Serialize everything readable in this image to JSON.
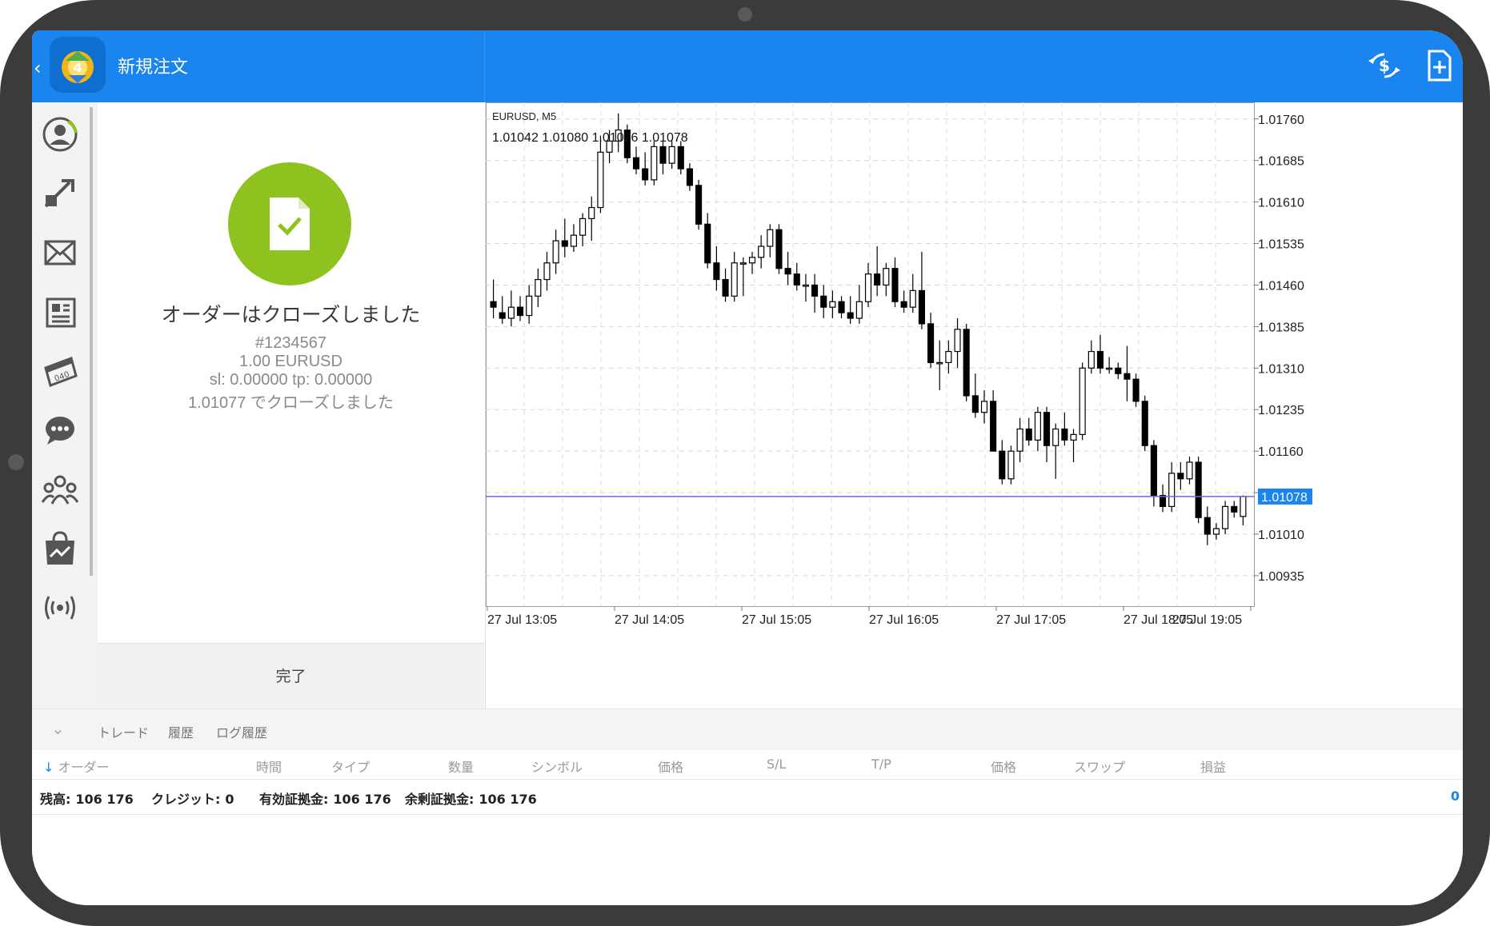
{
  "header": {
    "title": "新規注文"
  },
  "order_result": {
    "message": "オーダーはクローズしました",
    "ticket": "#1234567",
    "volume_symbol": "1.00 EURUSD",
    "sl_tp": "sl: 0.00000 tp: 0.00000",
    "close_text": "1.01077 でクローズしました",
    "done_label": "完了"
  },
  "chart": {
    "symbol_tf": "EURUSD, M5",
    "ohlc": "1.01042 1.01080 1.01026 1.01078",
    "current_price": "1.01078"
  },
  "chart_data": {
    "type": "candlestick",
    "symbol": "EURUSD",
    "timeframe": "M5",
    "y_ticks": [
      "1.01760",
      "1.01685",
      "1.01610",
      "1.01535",
      "1.01460",
      "1.01385",
      "1.01310",
      "1.01235",
      "1.01160",
      "1.01085",
      "1.01010",
      "1.00935"
    ],
    "x_ticks": [
      "27 Jul 13:05",
      "27 Jul 14:05",
      "27 Jul 15:05",
      "27 Jul 16:05",
      "27 Jul 17:05",
      "27 Jul 18:05",
      "27 Jul 19:05"
    ],
    "ylim": [
      1.0088,
      1.0179
    ],
    "last_price": 1.01078,
    "candles": [
      [
        1.0143,
        1.0147,
        1.014,
        1.0142
      ],
      [
        1.0141,
        1.0144,
        1.0139,
        1.014
      ],
      [
        1.014,
        1.0145,
        1.01385,
        1.0142
      ],
      [
        1.0142,
        1.0144,
        1.01395,
        1.01405
      ],
      [
        1.01405,
        1.0146,
        1.0139,
        1.0144
      ],
      [
        1.0144,
        1.0149,
        1.0142,
        1.0147
      ],
      [
        1.0147,
        1.0152,
        1.0145,
        1.015
      ],
      [
        1.015,
        1.0156,
        1.0148,
        1.0154
      ],
      [
        1.0154,
        1.0158,
        1.0151,
        1.0153
      ],
      [
        1.0153,
        1.0157,
        1.0152,
        1.0155
      ],
      [
        1.0155,
        1.0159,
        1.0153,
        1.0158
      ],
      [
        1.0158,
        1.0162,
        1.0154,
        1.016
      ],
      [
        1.016,
        1.0173,
        1.0159,
        1.017
      ],
      [
        1.017,
        1.0174,
        1.0168,
        1.0172
      ],
      [
        1.0172,
        1.0177,
        1.017,
        1.0174
      ],
      [
        1.0174,
        1.0175,
        1.0168,
        1.0169
      ],
      [
        1.0169,
        1.0171,
        1.0166,
        1.0167
      ],
      [
        1.0167,
        1.017,
        1.0164,
        1.0165
      ],
      [
        1.0165,
        1.0172,
        1.0164,
        1.0171
      ],
      [
        1.0171,
        1.0172,
        1.0166,
        1.0168
      ],
      [
        1.0168,
        1.0172,
        1.0167,
        1.0171
      ],
      [
        1.0171,
        1.0172,
        1.0166,
        1.0167
      ],
      [
        1.0167,
        1.0168,
        1.0163,
        1.0164
      ],
      [
        1.0164,
        1.0165,
        1.0156,
        1.0157
      ],
      [
        1.0157,
        1.0159,
        1.0149,
        1.015
      ],
      [
        1.015,
        1.0153,
        1.0145,
        1.0147
      ],
      [
        1.0147,
        1.0149,
        1.0143,
        1.0144
      ],
      [
        1.0144,
        1.0152,
        1.0143,
        1.015
      ],
      [
        1.015,
        1.0151,
        1.0144,
        1.015
      ],
      [
        1.015,
        1.0152,
        1.0148,
        1.0151
      ],
      [
        1.0151,
        1.0155,
        1.0149,
        1.0153
      ],
      [
        1.0153,
        1.0157,
        1.0151,
        1.0156
      ],
      [
        1.0156,
        1.0157,
        1.0148,
        1.0149
      ],
      [
        1.0149,
        1.0152,
        1.0146,
        1.0148
      ],
      [
        1.0148,
        1.015,
        1.0145,
        1.0146
      ],
      [
        1.0146,
        1.0148,
        1.0143,
        1.0146
      ],
      [
        1.0146,
        1.0148,
        1.0141,
        1.0144
      ],
      [
        1.0144,
        1.0146,
        1.014,
        1.0142
      ],
      [
        1.0142,
        1.0145,
        1.014,
        1.0143
      ],
      [
        1.0143,
        1.0144,
        1.014,
        1.0141
      ],
      [
        1.0141,
        1.0144,
        1.0139,
        1.014
      ],
      [
        1.014,
        1.0146,
        1.0139,
        1.0143
      ],
      [
        1.0143,
        1.015,
        1.0142,
        1.0148
      ],
      [
        1.0148,
        1.0153,
        1.0144,
        1.0146
      ],
      [
        1.0146,
        1.015,
        1.0144,
        1.0149
      ],
      [
        1.0149,
        1.0151,
        1.0142,
        1.0143
      ],
      [
        1.0143,
        1.0145,
        1.0141,
        1.0142
      ],
      [
        1.0142,
        1.0148,
        1.0141,
        1.0145
      ],
      [
        1.0145,
        1.0152,
        1.0138,
        1.0139
      ],
      [
        1.0139,
        1.0141,
        1.0131,
        1.0132
      ],
      [
        1.0132,
        1.0136,
        1.0127,
        1.0132
      ],
      [
        1.0132,
        1.0136,
        1.013,
        1.0134
      ],
      [
        1.0134,
        1.014,
        1.0131,
        1.0138
      ],
      [
        1.0138,
        1.0139,
        1.0125,
        1.0126
      ],
      [
        1.0126,
        1.013,
        1.0122,
        1.0123
      ],
      [
        1.0123,
        1.0127,
        1.0121,
        1.0125
      ],
      [
        1.0125,
        1.0127,
        1.0116,
        1.0116
      ],
      [
        1.0116,
        1.0118,
        1.011,
        1.0111
      ],
      [
        1.0111,
        1.0117,
        1.011,
        1.0116
      ],
      [
        1.0116,
        1.0122,
        1.0114,
        1.012
      ],
      [
        1.012,
        1.0122,
        1.0117,
        1.0118
      ],
      [
        1.0118,
        1.0124,
        1.0116,
        1.0123
      ],
      [
        1.0123,
        1.0124,
        1.0114,
        1.0117
      ],
      [
        1.0117,
        1.0121,
        1.0111,
        1.012
      ],
      [
        1.012,
        1.0123,
        1.0117,
        1.0118
      ],
      [
        1.0118,
        1.012,
        1.0114,
        1.0119
      ],
      [
        1.0119,
        1.0132,
        1.0118,
        1.0131
      ],
      [
        1.0131,
        1.0136,
        1.013,
        1.0134
      ],
      [
        1.0134,
        1.0137,
        1.013,
        1.0131
      ],
      [
        1.0131,
        1.0133,
        1.013,
        1.0131
      ],
      [
        1.0131,
        1.0132,
        1.0129,
        1.013
      ],
      [
        1.013,
        1.0135,
        1.0125,
        1.0129
      ],
      [
        1.0129,
        1.013,
        1.0124,
        1.0125
      ],
      [
        1.0125,
        1.0126,
        1.0116,
        1.0117
      ],
      [
        1.0117,
        1.0118,
        1.0106,
        1.0108
      ],
      [
        1.0108,
        1.011,
        1.0105,
        1.0106
      ],
      [
        1.0106,
        1.0114,
        1.0105,
        1.0112
      ],
      [
        1.0112,
        1.0114,
        1.0109,
        1.0111
      ],
      [
        1.0111,
        1.0115,
        1.011,
        1.0114
      ],
      [
        1.0114,
        1.0115,
        1.0103,
        1.0104
      ],
      [
        1.0104,
        1.0106,
        1.0099,
        1.0101
      ],
      [
        1.0101,
        1.0103,
        1.01,
        1.0102
      ],
      [
        1.0102,
        1.0107,
        1.0101,
        1.0106
      ],
      [
        1.0106,
        1.0107,
        1.0104,
        1.0105
      ],
      [
        1.01042,
        1.0108,
        1.01026,
        1.01078
      ]
    ]
  },
  "terminal": {
    "tabs": [
      "トレード",
      "履歴",
      "ログ履歴"
    ],
    "columns": [
      "オーダー",
      "時間",
      "タイプ",
      "数量",
      "シンボル",
      "価格",
      "S/L",
      "T/P",
      "価格",
      "スワップ",
      "損益"
    ],
    "summary": {
      "balance_label": "残高:",
      "balance": "106 176",
      "credit_label": "クレジット:",
      "credit": "0",
      "equity_label": "有効証拠金:",
      "equity": "106 176",
      "free_margin_label": "余剰証拠金:",
      "free_margin": "106 176",
      "profit": "0"
    }
  },
  "colors": {
    "accent": "#1a85ee",
    "success": "#8dc21f",
    "price_line": "#6a6ad8",
    "grid": "#d8d8d8"
  }
}
